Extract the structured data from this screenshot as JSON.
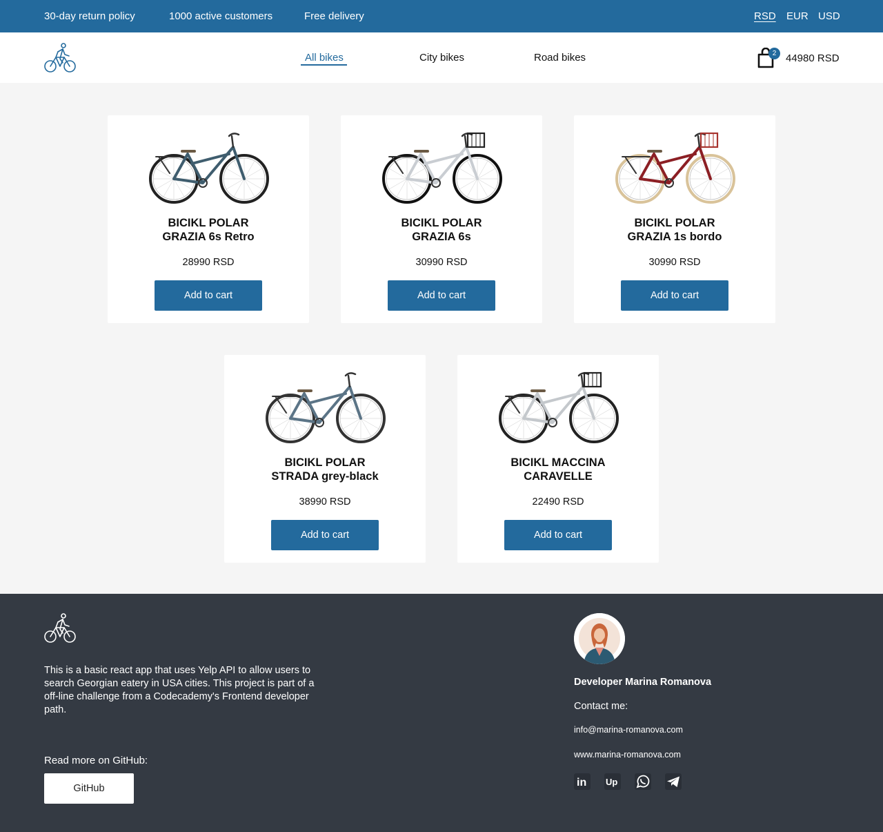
{
  "topbar": {
    "perks": [
      "30-day return policy",
      "1000 active customers",
      "Free delivery"
    ],
    "currencies": [
      "RSD",
      "EUR",
      "USD"
    ],
    "active_currency": "RSD"
  },
  "nav": {
    "items": [
      "All bikes",
      "City bikes",
      "Road bikes"
    ],
    "active": "All bikes"
  },
  "cart": {
    "count": "2",
    "total": "44980 RSD"
  },
  "products": [
    {
      "name_line1": "BICIKL POLAR",
      "name_line2": "GRAZIA 6s Retro",
      "price": "28990 RSD",
      "button": "Add to cart",
      "frame_color": "#3f5d6e",
      "tire_color": "#222222",
      "basket": "none"
    },
    {
      "name_line1": "BICIKL POLAR",
      "name_line2": "GRAZIA 6s",
      "price": "30990 RSD",
      "button": "Add to cart",
      "frame_color": "#c9cdd2",
      "tire_color": "#111111",
      "basket": "#222222"
    },
    {
      "name_line1": "BICIKL POLAR",
      "name_line2": "GRAZIA 1s bordo",
      "price": "30990 RSD",
      "button": "Add to cart",
      "frame_color": "#8c1f24",
      "tire_color": "#d9c39a",
      "basket": "#a8342e"
    },
    {
      "name_line1": "BICIKL POLAR",
      "name_line2": "STRADA grey-black",
      "price": "38990 RSD",
      "button": "Add to cart",
      "frame_color": "#5b7486",
      "tire_color": "#333333",
      "basket": "none"
    },
    {
      "name_line1": "BICIKL MACCINA",
      "name_line2": "CARAVELLE",
      "price": "22490 RSD",
      "button": "Add to cart",
      "frame_color": "#c4c8cc",
      "tire_color": "#222222",
      "basket": "#222222"
    }
  ],
  "footer": {
    "about": "This is a basic react app that uses Yelp API to allow users to search Georgian eatery in USA cities. This project is part of a off-line challenge from a Codecademy's Frontend developer path.",
    "read_more": "Read more on GitHub:",
    "github_button": "GitHub",
    "developer": "Developer Marina Romanova",
    "contact_label": "Contact me:",
    "email": "info@marina-romanova.com",
    "website": "www.marina-romanova.com",
    "socials": [
      "linkedin-icon",
      "upwork-icon",
      "whatsapp-icon",
      "telegram-icon"
    ]
  },
  "colors": {
    "brand": "#236a9d",
    "footer_bg": "#343a43",
    "page_bg": "#f5f5f5"
  }
}
